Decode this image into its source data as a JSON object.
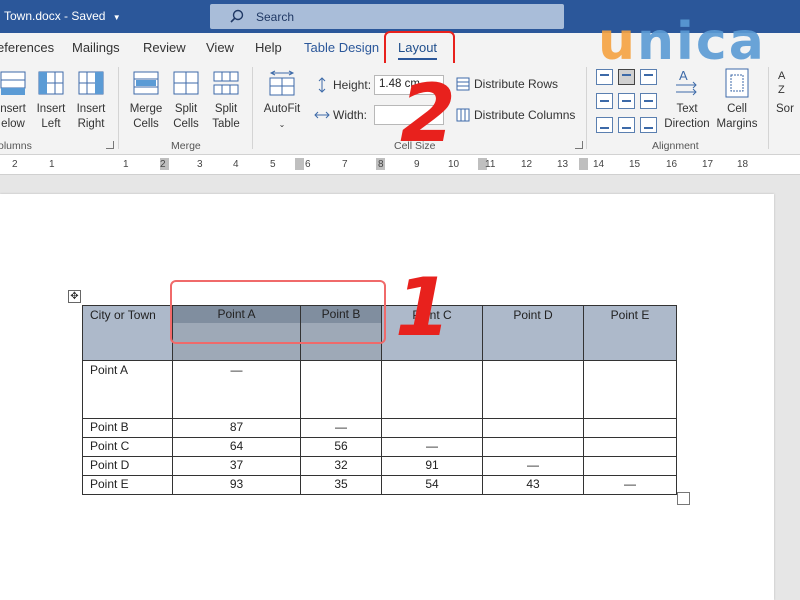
{
  "titlebar": {
    "doc_title": "Town.docx",
    "saved_status": "Saved",
    "search_placeholder": "Search"
  },
  "tabs": [
    {
      "label": "eferences"
    },
    {
      "label": "Mailings"
    },
    {
      "label": "Review"
    },
    {
      "label": "View"
    },
    {
      "label": "Help"
    },
    {
      "label": "Table Design"
    },
    {
      "label": "Layout",
      "active": true
    }
  ],
  "ribbon": {
    "insert_below": [
      "nsert",
      "elow"
    ],
    "insert_left": [
      "Insert",
      "Left"
    ],
    "insert_right": [
      "Insert",
      "Right"
    ],
    "group_columns": "olumns",
    "merge_cells": [
      "Merge",
      "Cells"
    ],
    "split_cells": [
      "Split",
      "Cells"
    ],
    "split_table": [
      "Split",
      "Table"
    ],
    "group_merge": "Merge",
    "autofit": "AutoFit",
    "height_label": "Height:",
    "height_value": "1.48 cm",
    "width_label": "Width:",
    "width_value": "",
    "distribute_rows": "Distribute Rows",
    "distribute_columns": "Distribute Columns",
    "group_cell_size": "Cell Size",
    "text_direction": [
      "Text",
      "Direction"
    ],
    "cell_margins": [
      "Cell",
      "Margins"
    ],
    "group_alignment": "Alignment",
    "sort": "Sor"
  },
  "ruler": {
    "labels": [
      "2",
      "1",
      "1",
      "2",
      "3",
      "4",
      "5",
      "6",
      "7",
      "8",
      "9",
      "10",
      "11",
      "12",
      "13",
      "14",
      "15",
      "16",
      "17",
      "18"
    ]
  },
  "table": {
    "headers": [
      "City or Town",
      "Point A",
      "Point B",
      "Point C",
      "Point D",
      "Point E"
    ],
    "rows": [
      [
        "Point A",
        "—",
        "",
        "",
        "",
        ""
      ],
      [
        "Point B",
        "87",
        "—",
        "",
        "",
        ""
      ],
      [
        "Point C",
        "64",
        "56",
        "—",
        "",
        ""
      ],
      [
        "Point D",
        "37",
        "32",
        "91",
        "—",
        ""
      ],
      [
        "Point E",
        "93",
        "35",
        "54",
        "43",
        "—"
      ]
    ]
  },
  "annotations": {
    "step_1": "1",
    "step_2": "2"
  },
  "logo": {
    "part1": "u",
    "part2": "nica",
    "colors": {
      "orange": "#f6a341",
      "blue": "#5b9bd5"
    }
  },
  "colors": {
    "titlebar": "#2b579a",
    "header_fill": "#adb9ca",
    "selected_fill": "#7d8a9c",
    "annotation_red": "#e8211d"
  }
}
